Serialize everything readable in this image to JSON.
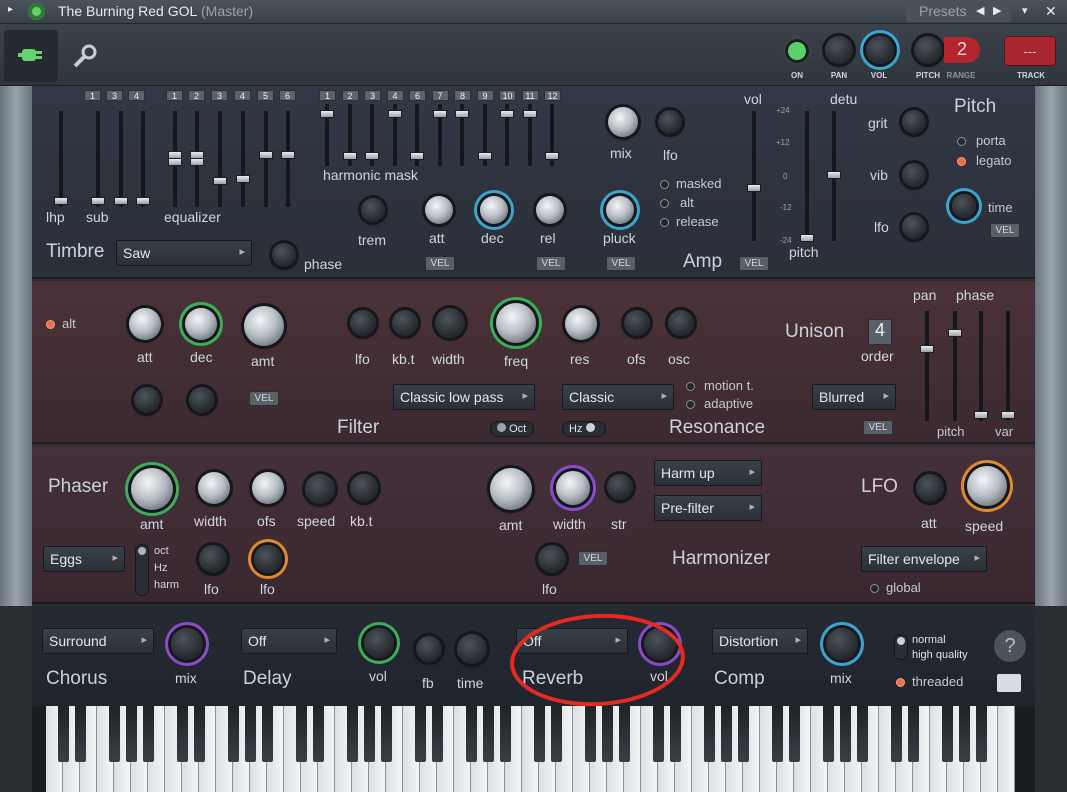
{
  "titlebar": {
    "arrow": "▸",
    "name": "The Burning Red GOL",
    "mode": "(Master)",
    "presets": "Presets",
    "prev": "◀",
    "next": "▶",
    "menu": "▾",
    "close": "✕"
  },
  "toolbar": {
    "on": "ON",
    "pan": "PAN",
    "vol": "VOL",
    "pitch": "PITCH",
    "range": "RANGE",
    "range_value": "2",
    "track": "TRACK",
    "track_value": "---"
  },
  "timbre": {
    "title": "Timbre",
    "waveform": "Saw",
    "phase": "phase",
    "lhp": "lhp",
    "sub": "sub",
    "equalizer": "equalizer",
    "harmonic_mask": "harmonic mask",
    "sub_nums": [
      "1",
      "3",
      "4"
    ],
    "eq_nums": [
      "1",
      "2",
      "3",
      "4",
      "5",
      "6"
    ],
    "harm_nums": [
      "1",
      "2",
      "3",
      "4",
      "6",
      "7",
      "8",
      "9",
      "10",
      "11",
      "12"
    ],
    "mix": "mix",
    "lfo": "lfo",
    "trem": "trem",
    "att": "att",
    "dec": "dec",
    "rel": "rel",
    "pluck": "pluck",
    "masked": "masked",
    "alt": "alt",
    "release": "release",
    "amp": "Amp",
    "vel": "VEL"
  },
  "pitchpanel": {
    "vol": "vol",
    "detu": "detu",
    "pitch": "pitch",
    "scale": [
      "+24",
      "+12",
      "0",
      "-12",
      "-24"
    ],
    "title": "Pitch",
    "grit": "grit",
    "vib": "vib",
    "lfo": "lfo",
    "porta": "porta",
    "legato": "legato",
    "time": "time",
    "vel": "VEL"
  },
  "filter": {
    "alt": "alt",
    "att": "att",
    "dec": "dec",
    "amt": "amt",
    "vel": "VEL",
    "lfo": "lfo",
    "kbt": "kb.t",
    "width": "width",
    "freq": "freq",
    "res": "res",
    "ofs": "ofs",
    "osc": "osc",
    "title": "Filter",
    "type": "Classic low pass",
    "oct": "Oct",
    "res_type": "Classic",
    "hz": "Hz",
    "motion": "motion t.",
    "adaptive": "adaptive",
    "resonance": "Resonance",
    "unison": "Unison",
    "order_value": "4",
    "order": "order",
    "pan": "pan",
    "phase": "phase",
    "pitch": "pitch",
    "var": "var",
    "blur": "Blurred",
    "vel2": "VEL"
  },
  "phaser": {
    "title": "Phaser",
    "amt": "amt",
    "width": "width",
    "ofs": "ofs",
    "speed": "speed",
    "kbt": "kb.t",
    "preset": "Eggs",
    "oct": "oct",
    "hz": "Hz",
    "harm": "harm",
    "lfo1": "lfo",
    "lfo2": "lfo",
    "h_amt": "amt",
    "h_width": "width",
    "h_str": "str",
    "harm_up": "Harm up",
    "prefilter": "Pre-filter",
    "vel": "VEL",
    "h_lfo": "lfo",
    "harmonizer": "Harmonizer",
    "lfo_title": "LFO",
    "lfo_att": "att",
    "lfo_speed": "speed",
    "envelope": "Filter envelope",
    "global": "global"
  },
  "fx": {
    "chorus_type": "Surround",
    "chorus": "Chorus",
    "chorus_mix": "mix",
    "delay_type": "Off",
    "delay": "Delay",
    "delay_vol": "vol",
    "delay_fb": "fb",
    "delay_time": "time",
    "reverb_type": "Off",
    "reverb": "Reverb",
    "reverb_vol": "vol",
    "comp_type": "Distortion",
    "comp": "Comp",
    "comp_mix": "mix",
    "normal": "normal",
    "high": "high quality",
    "threaded": "threaded",
    "help": "?"
  }
}
